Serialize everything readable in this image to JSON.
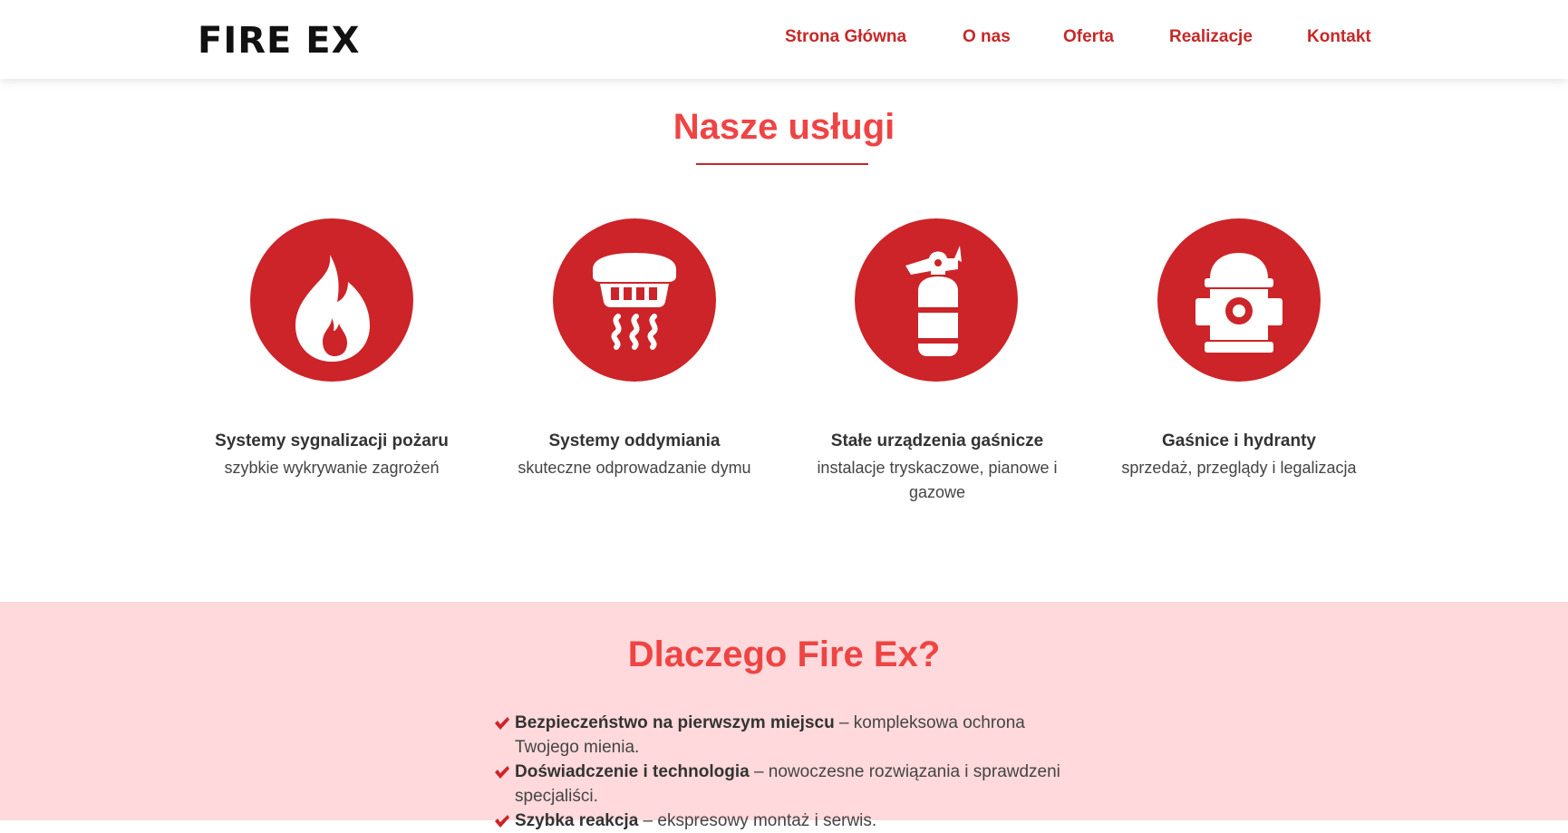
{
  "header": {
    "logo": "FIRE EX",
    "nav": [
      "Strona Główna",
      "O nas",
      "Oferta",
      "Realizacje",
      "Kontakt"
    ]
  },
  "services": {
    "title": "Nasze usługi",
    "items": [
      {
        "icon": "fire-icon",
        "title": "Systemy sygnalizacji pożaru",
        "desc": "szybkie wykrywanie zagrożeń"
      },
      {
        "icon": "smoke-detector-icon",
        "title": "Systemy oddymiania",
        "desc": "skuteczne odprowadzanie dymu"
      },
      {
        "icon": "fire-extinguisher-icon",
        "title": "Stałe urządzenia gaśnicze",
        "desc": "instalacje tryskaczowe, pianowe i gazowe"
      },
      {
        "icon": "fire-hydrant-icon",
        "title": "Gaśnice i hydranty",
        "desc": "sprzedaż, przeglądy i legalizacja"
      }
    ]
  },
  "why": {
    "title": "Dlaczego Fire Ex?",
    "items": [
      {
        "bold": "Bezpieczeństwo na pierwszym miejscu",
        "text": " – kompleksowa ochrona Twojego mienia."
      },
      {
        "bold": "Doświadczenie i technologia",
        "text": " – nowoczesne rozwiązania i sprawdzeni specjaliści."
      },
      {
        "bold": "Szybka reakcja",
        "text": " – ekspresowy montaż i serwis."
      }
    ]
  },
  "colors": {
    "accent": "#cc2428",
    "heading": "#ef4444",
    "why_background": "#ffd9db"
  }
}
